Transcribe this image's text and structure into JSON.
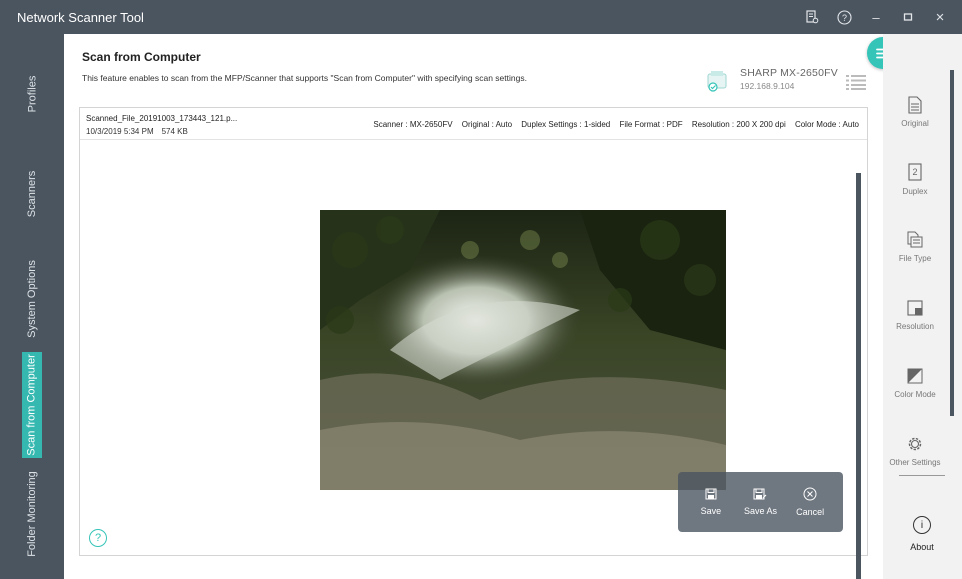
{
  "app": {
    "title": "Network Scanner Tool"
  },
  "titlebar": {
    "buttons": [
      "report-icon",
      "help-icon",
      "minimize-icon",
      "maximize-icon",
      "close-icon"
    ],
    "help_glyph": "?",
    "minimize_glyph": "–",
    "close_glyph": "×"
  },
  "leftnav": {
    "items": [
      {
        "label": "Profiles"
      },
      {
        "label": "Scanners"
      },
      {
        "label": "System Options"
      },
      {
        "label": "Scan from Computer"
      },
      {
        "label": "Folder Monitoring"
      }
    ],
    "active_index": 3
  },
  "main": {
    "title": "Scan from Computer",
    "description": "This feature enables to scan from the MFP/Scanner that supports \"Scan from Computer\" with specifying scan settings.",
    "scanner": {
      "name": "SHARP MX-2650FV",
      "ip": "192.168.9.104"
    },
    "document": {
      "file_name": "Scanned_File_20191003_173443_121.p...",
      "date": "10/3/2019 5:34 PM",
      "size": "574 KB",
      "settings": [
        {
          "key": "Scanner :",
          "value": "MX-2650FV"
        },
        {
          "key": "Original :",
          "value": "Auto"
        },
        {
          "key": "Duplex Settings :",
          "value": "1-sided"
        },
        {
          "key": "File Format :",
          "value": "PDF"
        },
        {
          "key": "Resolution :",
          "value": "200 X 200 dpi"
        },
        {
          "key": "Color Mode :",
          "value": "Auto"
        }
      ]
    },
    "actions": [
      {
        "label": "Save",
        "icon": "save-icon"
      },
      {
        "label": "Save As",
        "icon": "save-as-icon"
      },
      {
        "label": "Cancel",
        "icon": "cancel-icon"
      }
    ],
    "help_glyph": "?"
  },
  "rightnav": {
    "items": [
      {
        "label": "Original",
        "icon": "original-icon"
      },
      {
        "label": "Duplex",
        "icon": "duplex-icon"
      },
      {
        "label": "File Type",
        "icon": "file-type-icon"
      },
      {
        "label": "Resolution",
        "icon": "resolution-icon"
      },
      {
        "label": "Color Mode",
        "icon": "color-mode-icon"
      },
      {
        "label": "Other Settings",
        "icon": "gear-icon"
      }
    ],
    "about": {
      "label": "About",
      "glyph": "i"
    }
  },
  "colors": {
    "accent": "#35c4b8",
    "nav_bg": "#4b5560",
    "active_nav": "#35b8b0"
  }
}
